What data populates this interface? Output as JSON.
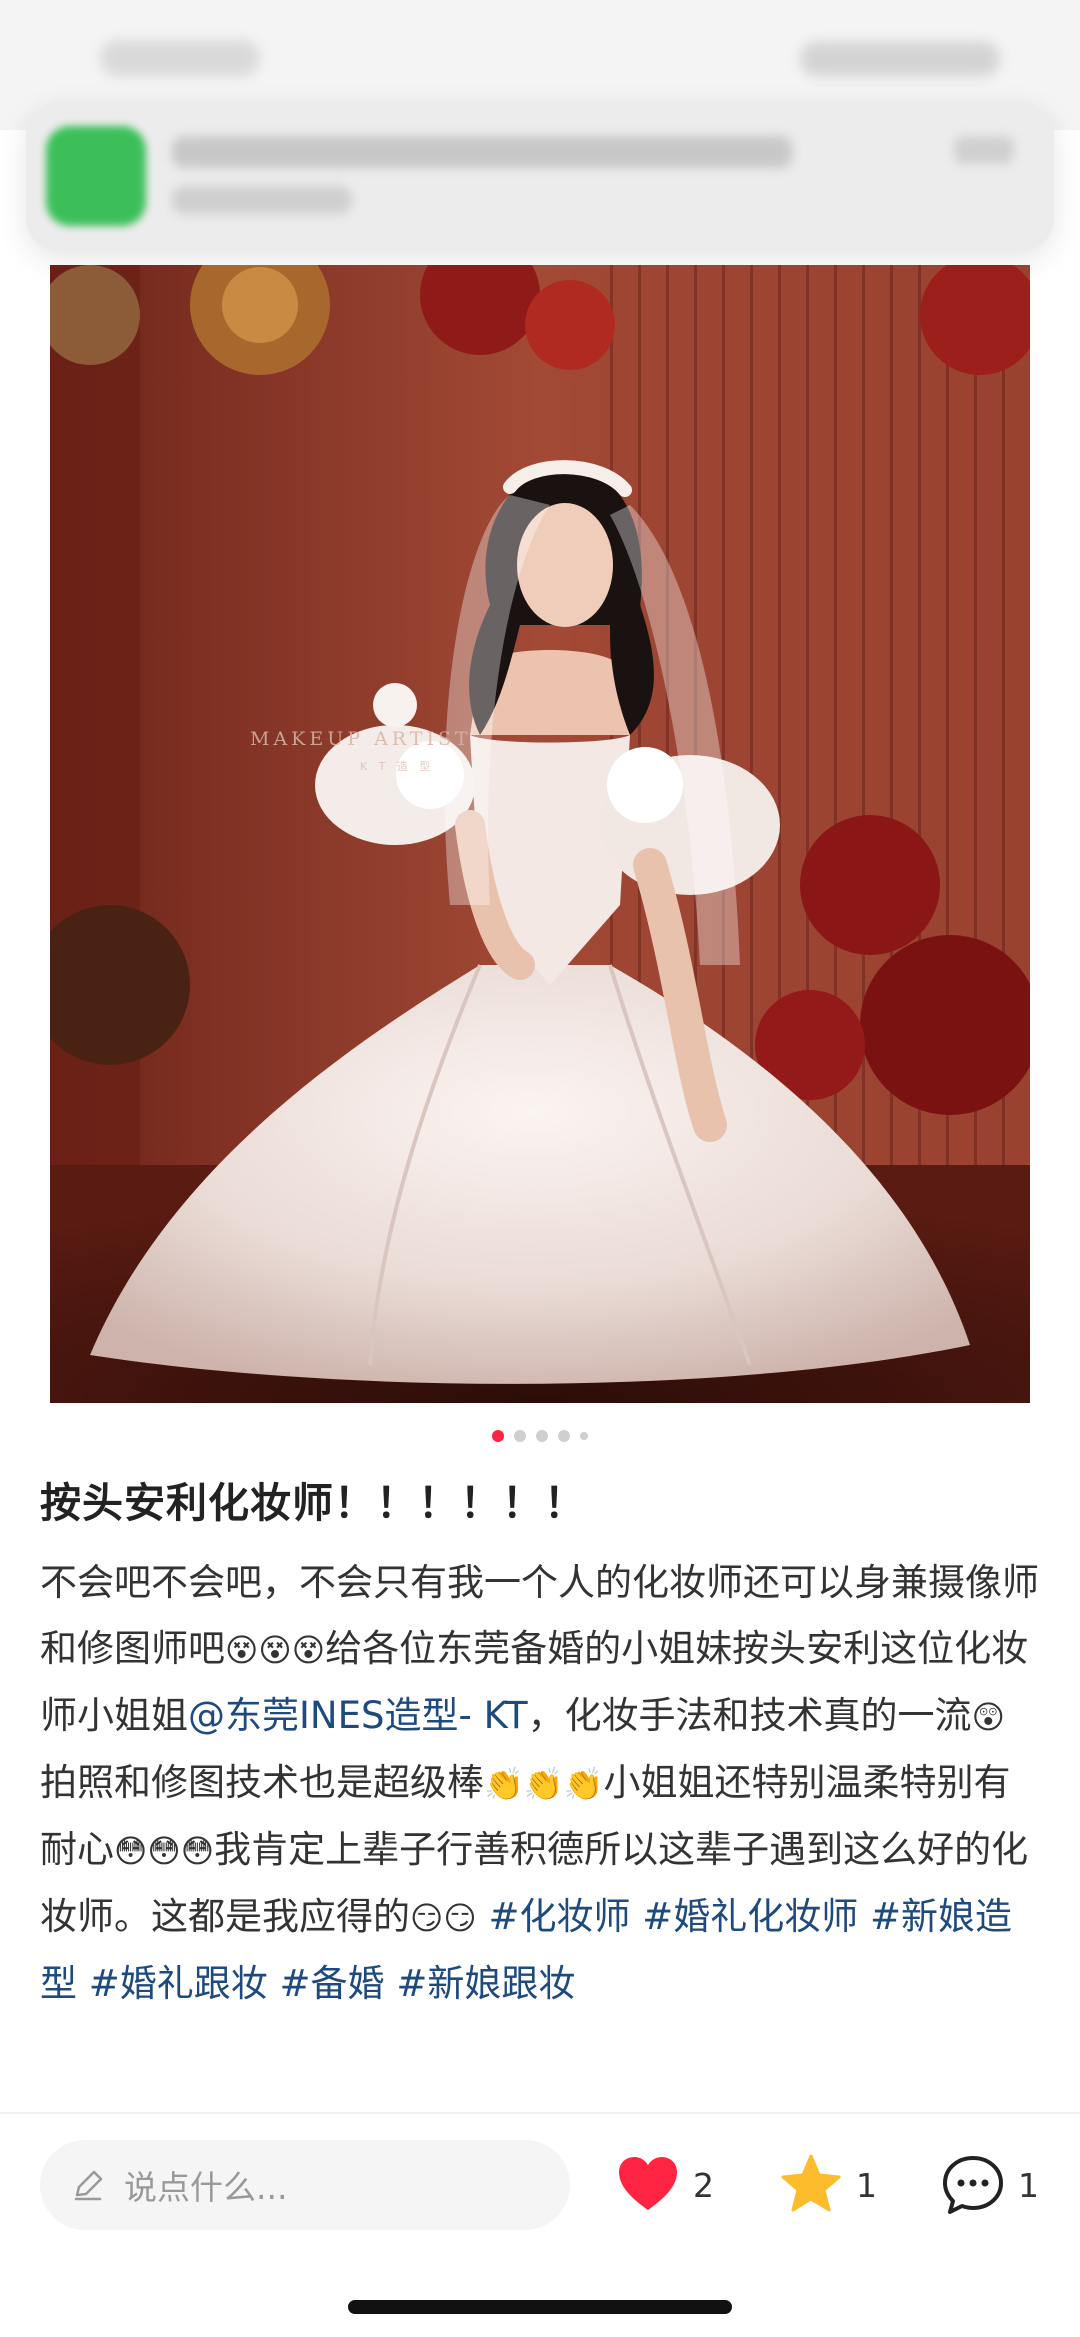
{
  "photo": {
    "watermark_line1": "MAKEUP ARTIST",
    "watermark_line2": "K T 造 型"
  },
  "carousel": {
    "total_dots": 5,
    "active_index": 0
  },
  "post": {
    "title": "按头安利化妆师！！！！！！",
    "body_segments": {
      "s1": "不会吧不会吧，不会只有我一个人的化妆师还可以身兼摄像师和修图师吧",
      "e1": "😵😵😵",
      "s2": "给各位东莞备婚的小姐妹按头安利这位化妆师小姐姐",
      "mention": "@东莞INES造型- KT",
      "s3": "，化妆手法和技术真的一流",
      "e2": "😲",
      "s4": "拍照和修图技术也是超级棒",
      "e3": "👏👏👏",
      "s5": "小姐姐还特别温柔特别有耐心",
      "e4": "😳😳😳",
      "s6": "我肯定上辈子行善积德所以这辈子遇到这么好的化妆师。这都是我应得的",
      "e5": "😏😏"
    },
    "tags": [
      "#化妆师",
      "#婚礼化妆师",
      "#新娘造型",
      "#婚礼跟妆",
      "#备婚",
      "#新娘跟妆"
    ]
  },
  "bottom_bar": {
    "comment_placeholder": "说点什么...",
    "like_count": "2",
    "collect_count": "1",
    "comment_count": "1",
    "like_color": "#ff2442",
    "collect_color": "#fdbc2c",
    "icons": [
      "pencil-icon",
      "heart-icon",
      "star-icon",
      "speech-bubble-icon"
    ]
  }
}
